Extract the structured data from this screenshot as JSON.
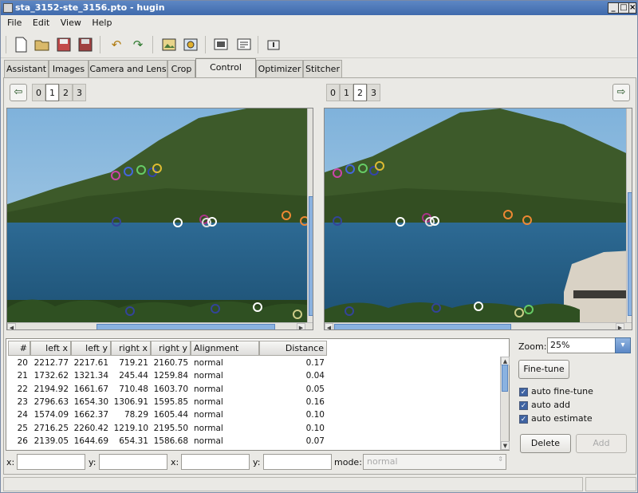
{
  "window": {
    "title": "sta_3152-ste_3156.pto - hugin"
  },
  "menu": [
    "File",
    "Edit",
    "View",
    "Help"
  ],
  "toolbar_icons": [
    "new-file-icon",
    "open-folder-icon",
    "save-icon",
    "save-as-icon",
    "undo-icon",
    "redo-icon",
    "preview-icon",
    "fast-preview-icon",
    "images-icon",
    "properties-icon",
    "camera-icon"
  ],
  "tabs": [
    "Assistant",
    "Images",
    "Camera and Lens",
    "Crop",
    "Control Points",
    "Optimizer",
    "Stitcher"
  ],
  "active_tab": "Control Points",
  "left_images": [
    "0",
    "1",
    "2",
    "3"
  ],
  "left_selected": "1",
  "right_images": [
    "0",
    "1",
    "2",
    "3"
  ],
  "right_selected": "2",
  "table": {
    "headers": [
      "#",
      "left x",
      "left y",
      "right x",
      "right y",
      "Alignment",
      "Distance"
    ],
    "rows": [
      [
        "20",
        "2212.77",
        "2217.61",
        "719.21",
        "2160.75",
        "normal",
        "0.17"
      ],
      [
        "21",
        "1732.62",
        "1321.34",
        "245.44",
        "1259.84",
        "normal",
        "0.04"
      ],
      [
        "22",
        "2194.92",
        "1661.67",
        "710.48",
        "1603.70",
        "normal",
        "0.05"
      ],
      [
        "23",
        "2796.63",
        "1654.30",
        "1306.91",
        "1595.85",
        "normal",
        "0.16"
      ],
      [
        "24",
        "1574.09",
        "1662.37",
        "78.29",
        "1605.44",
        "normal",
        "0.10"
      ],
      [
        "25",
        "2716.25",
        "2260.42",
        "1219.10",
        "2195.50",
        "normal",
        "0.10"
      ],
      [
        "26",
        "2139.05",
        "1644.69",
        "654.31",
        "1586.68",
        "normal",
        "0.07"
      ]
    ]
  },
  "edit": {
    "x_label": "x:",
    "y_label": "y:",
    "mode_label": "mode:",
    "mode_value": "normal"
  },
  "zoom": {
    "label": "Zoom:",
    "value": "25%"
  },
  "buttons": {
    "fine_tune": "Fine-tune",
    "delete": "Delete",
    "add": "Add"
  },
  "options": [
    {
      "label": "auto fine-tune",
      "checked": true
    },
    {
      "label": "auto add",
      "checked": true
    },
    {
      "label": "auto estimate",
      "checked": true
    }
  ]
}
